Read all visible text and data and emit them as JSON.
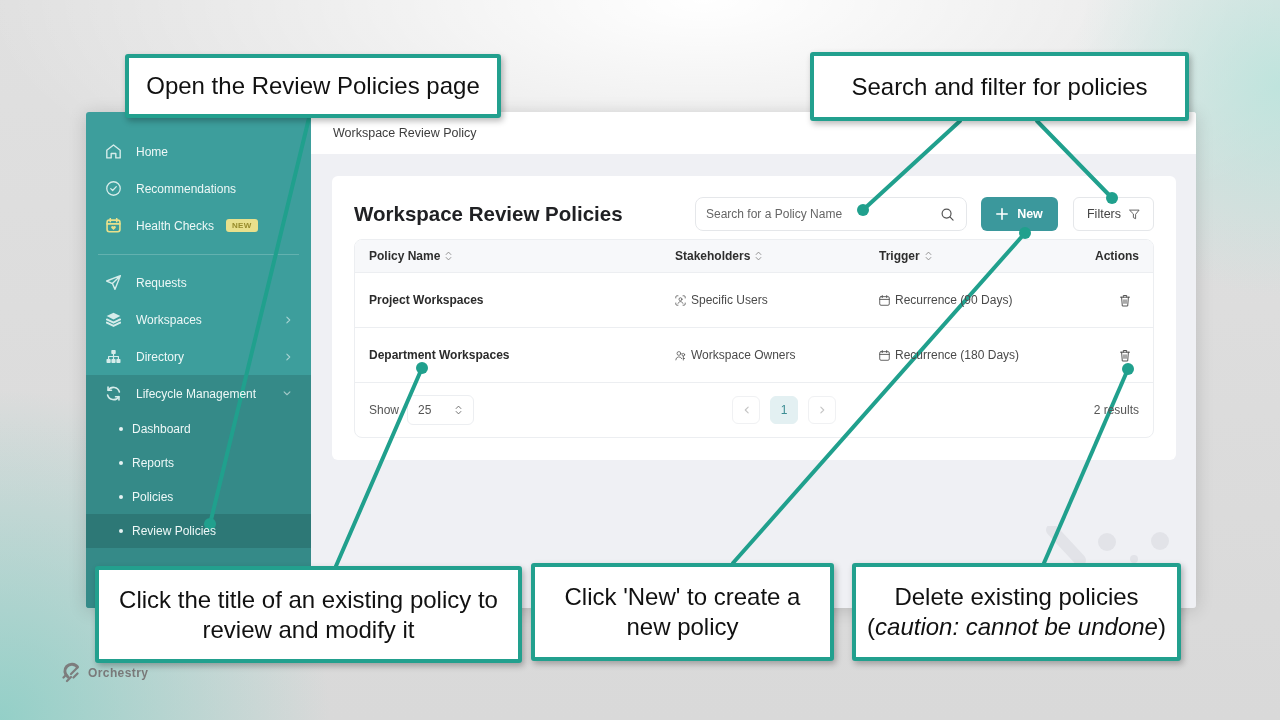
{
  "app": {
    "breadcrumb": "Workspace Review Policy"
  },
  "sidebar": {
    "sections": [
      {
        "items": [
          {
            "label": "Home",
            "selected": false
          },
          {
            "label": "Recommendations",
            "selected": false
          },
          {
            "label": "Health Checks",
            "badge": "NEW",
            "selected": false
          }
        ]
      },
      {
        "items": [
          {
            "label": "Requests",
            "selected": false
          },
          {
            "label": "Workspaces",
            "expanded": false,
            "selected": false
          },
          {
            "label": "Directory",
            "expanded": false,
            "selected": false
          },
          {
            "label": "Lifecycle Management",
            "expanded": true,
            "selected": false,
            "children": [
              {
                "label": "Dashboard",
                "selected": false
              },
              {
                "label": "Reports",
                "selected": false
              },
              {
                "label": "Policies",
                "selected": false
              },
              {
                "label": "Review Policies",
                "selected": true
              }
            ]
          }
        ]
      }
    ]
  },
  "page": {
    "title": "Workspace Review Policies",
    "search": {
      "placeholder": "Search for a Policy Name"
    },
    "new_button": {
      "label": "New"
    },
    "filters_button": {
      "label": "Filters"
    }
  },
  "table": {
    "columns": [
      {
        "label": "Policy Name",
        "sortable": true
      },
      {
        "label": "Stakeholders",
        "sortable": true
      },
      {
        "label": "Trigger",
        "sortable": true
      },
      {
        "label": "Actions",
        "sortable": false
      }
    ],
    "rows": [
      {
        "policy_name": "Project Workspaces",
        "stakeholders": {
          "text": "Specific Users",
          "kind": "users"
        },
        "trigger": "Recurrence (90 Days)"
      },
      {
        "policy_name": "Department Workspaces",
        "stakeholders": {
          "text": "Workspace Owners",
          "kind": "owners"
        },
        "trigger": "Recurrence (180 Days)"
      }
    ],
    "footer": {
      "show_label": "Show",
      "page_size": "25",
      "pages": [
        {
          "label": "1",
          "selected": true
        }
      ],
      "results": "2 results"
    }
  },
  "callouts": [
    {
      "text": "Open the Review Policies page"
    },
    {
      "text": "Search and filter for policies"
    },
    {
      "text": "Click the title of an existing policy to review and modify it"
    },
    {
      "text": "Click 'New' to create a new policy"
    },
    {
      "text": "Delete existing policies (*caution: cannot be undone*)"
    }
  ],
  "brand": {
    "name": "Orchestry"
  }
}
